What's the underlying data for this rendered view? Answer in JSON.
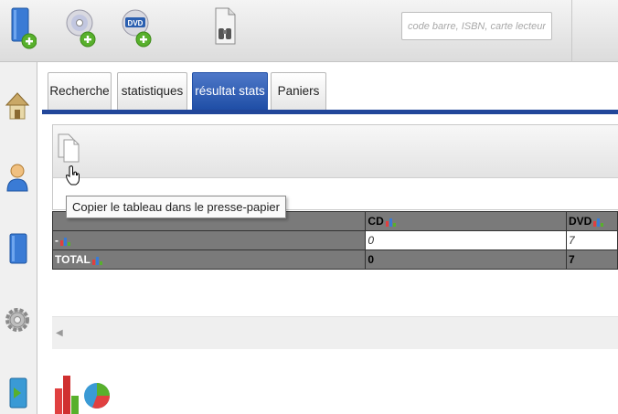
{
  "toolbar": {
    "search_placeholder": "code barre, ISBN, carte lecteur",
    "dvd_badge": "DVD"
  },
  "tabs": [
    {
      "label": "Recherche",
      "active": false
    },
    {
      "label": "statistiques",
      "active": false
    },
    {
      "label": "résultat stats",
      "active": true
    },
    {
      "label": "Paniers",
      "active": false
    }
  ],
  "panel": {
    "copy_tooltip": "Copier le tableau dans le presse-papier"
  },
  "table": {
    "headers": [
      "",
      "CD",
      "DVD"
    ],
    "rows": [
      {
        "label": "-",
        "values": [
          "0",
          "7"
        ]
      },
      {
        "label": "TOTAL",
        "values": [
          "0",
          "7"
        ]
      }
    ]
  },
  "scroll": {
    "left_arrow": "◀"
  },
  "colors": {
    "tab_active": "#1f4ea6",
    "tab_underline": "#22479a",
    "table_header": "#7a7a7a",
    "badge_green": "#58b02c"
  },
  "icons": [
    "add-book-icon",
    "add-cd-icon",
    "add-dvd-icon",
    "binoculars-icon",
    "home-icon",
    "user-icon",
    "book-icon",
    "gear-icon",
    "import-icon",
    "copy-icon",
    "bar-chart-icon",
    "pie-chart-icon"
  ]
}
